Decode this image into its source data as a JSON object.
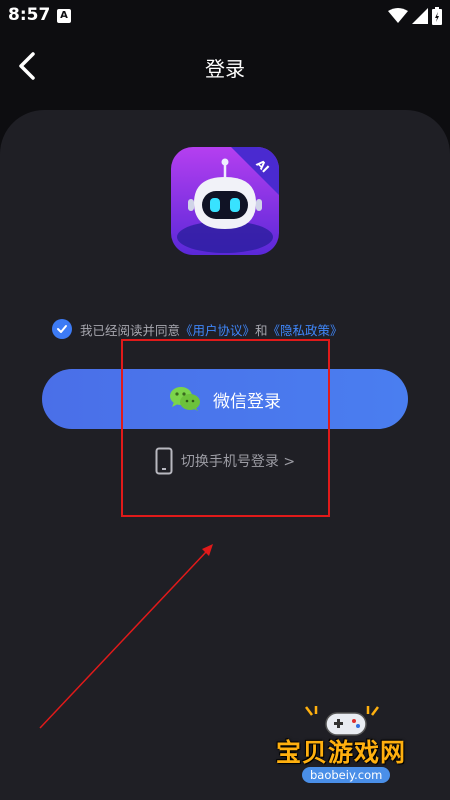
{
  "status_bar": {
    "time": "8:57",
    "notification_letter": "A"
  },
  "header": {
    "title": "登录",
    "back_icon": "chevron-left-icon"
  },
  "logo": {
    "badge_text": "AI"
  },
  "agreement": {
    "checked": true,
    "prefix": "我已经阅读并同意",
    "user_agreement": "《用户协议》",
    "conjunction": "和",
    "privacy_policy": "《隐私政策》"
  },
  "wechat_login": {
    "label": "微信登录",
    "icon": "wechat-icon"
  },
  "phone_login": {
    "label": "切换手机号登录 >",
    "icon": "phone-icon"
  },
  "watermark": {
    "text": "宝贝游戏网",
    "url": "baobeiy.com"
  },
  "colors": {
    "background": "#0d0d10",
    "card": "#1f1f25",
    "accent": "#4a74ec",
    "link": "#3f86f8",
    "annotation": "#e01a1a",
    "watermark": "#ffb00f"
  }
}
